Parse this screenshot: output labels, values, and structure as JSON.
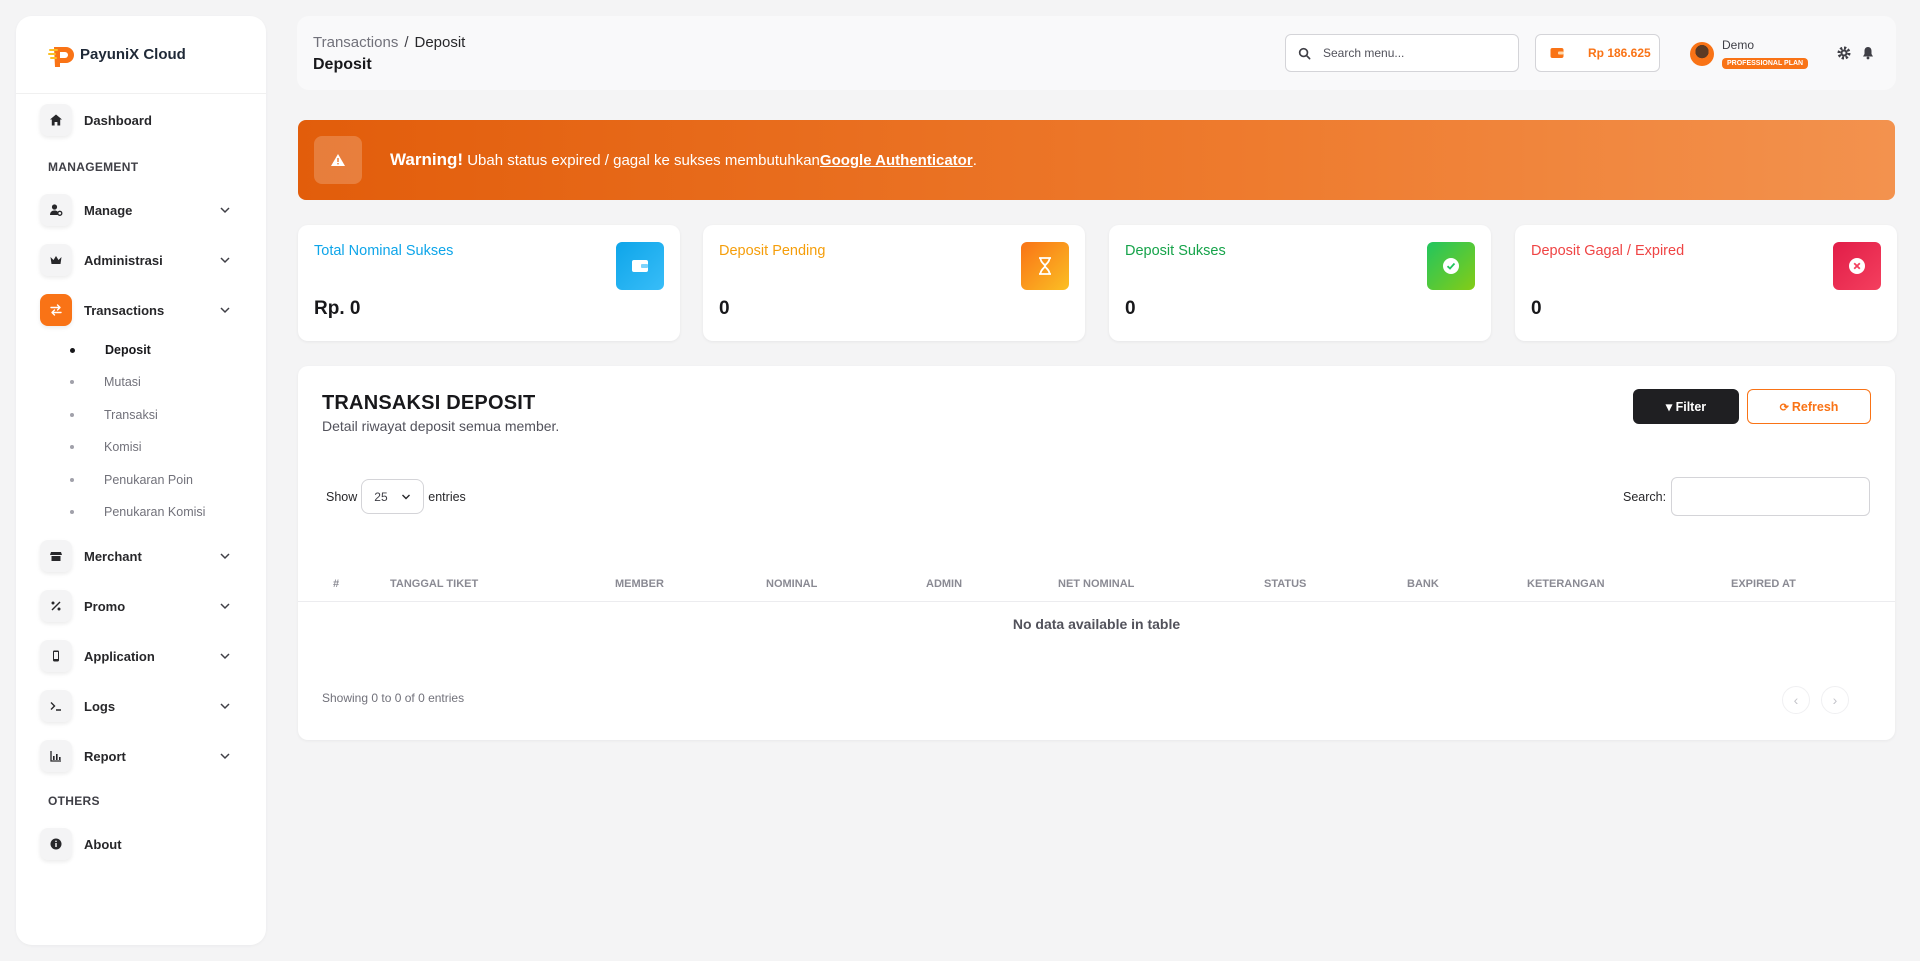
{
  "brand": {
    "name": "PayuniX Cloud"
  },
  "sidebar": {
    "dashboard": "Dashboard",
    "management_title": "MANAGEMENT",
    "manage": "Manage",
    "administrasi": "Administrasi",
    "transactions": "Transactions",
    "sub_items": [
      "Deposit",
      "Mutasi",
      "Transaksi",
      "Komisi",
      "Penukaran Poin",
      "Penukaran Komisi"
    ],
    "merchant": "Merchant",
    "promo": "Promo",
    "application": "Application",
    "logs": "Logs",
    "report": "Report",
    "others_title": "OTHERS",
    "about": "About"
  },
  "header": {
    "breadcrumb_parent": "Transactions",
    "breadcrumb_sep": "/",
    "breadcrumb_current": "Deposit",
    "title": "Deposit",
    "search_placeholder": "Search menu...",
    "balance": "Rp 186.625",
    "user_name": "Demo",
    "plan": "PROFESSIONAL PLAN"
  },
  "warning": {
    "label": "Warning!",
    "message": " Ubah status expired / gagal ke sukses membutuhkan",
    "link": "Google Authenticator",
    "end": "."
  },
  "stats": [
    {
      "title": "Total Nominal Sukses",
      "value": "Rp. 0",
      "color": "#0ea5e9",
      "icon": "wallet-icon"
    },
    {
      "title": "Deposit Pending",
      "value": "0",
      "color": "#f59e0b",
      "icon": "hourglass-icon"
    },
    {
      "title": "Deposit Sukses",
      "value": "0",
      "color": "#16a34a",
      "icon": "check-circle-icon"
    },
    {
      "title": "Deposit Gagal / Expired",
      "value": "0",
      "color": "#ef4444",
      "icon": "x-circle-icon"
    }
  ],
  "table": {
    "title": "TRANSAKSI DEPOSIT",
    "subtitle": "Detail riwayat deposit semua member.",
    "filter_label": "Filter",
    "refresh_label": "Refresh",
    "show_label": "Show",
    "entries_value": "25",
    "entries_label": "entries",
    "search_label": "Search:",
    "columns": [
      "#",
      "TANGGAL TIKET",
      "MEMBER",
      "NOMINAL",
      "ADMIN",
      "NET NOMINAL",
      "STATUS",
      "BANK",
      "KETERANGAN",
      "EXPIRED AT"
    ],
    "empty_text": "No data available in table",
    "info_text": "Showing 0 to 0 of 0 entries",
    "prev": "‹",
    "next": "›"
  },
  "colors": {
    "accent": "#f97316",
    "dark": "#1f1f22"
  }
}
